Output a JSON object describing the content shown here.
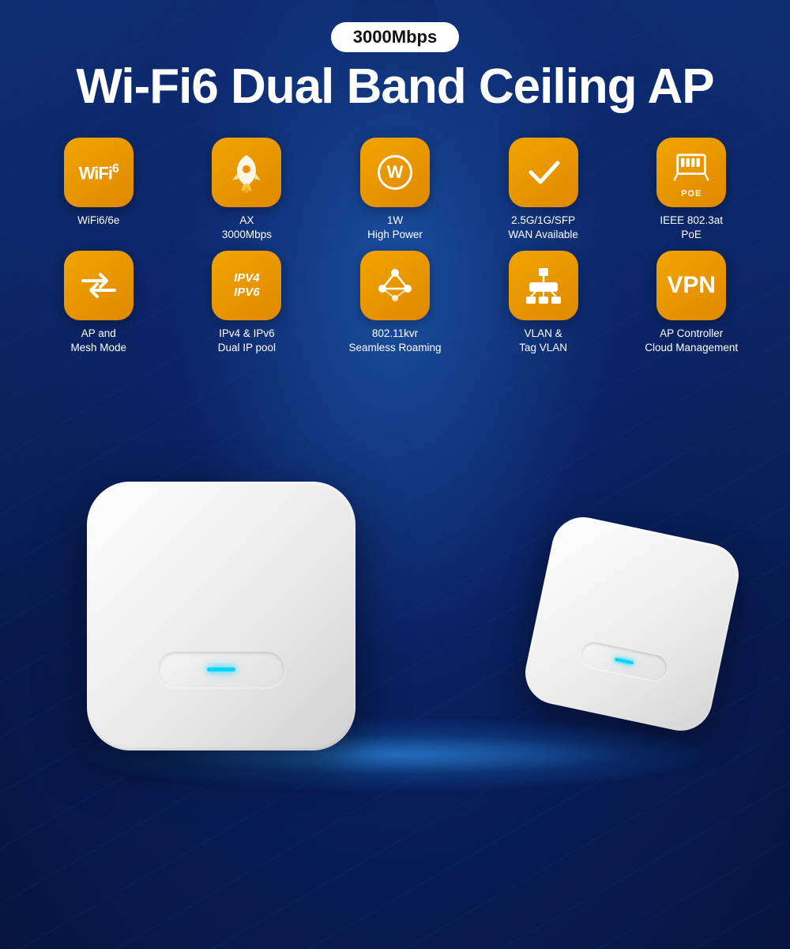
{
  "badge": {
    "text": "3000Mbps"
  },
  "title": {
    "line1": "Wi-Fi6  Dual Band Ceiling AP"
  },
  "features": {
    "row1": [
      {
        "id": "wifi6",
        "type": "wifi6-text",
        "label": "WiFi6/6e"
      },
      {
        "id": "ax",
        "type": "rocket",
        "label": "AX\n3000Mbps"
      },
      {
        "id": "power",
        "type": "w-circle",
        "label": "1W\nHigh Power"
      },
      {
        "id": "wan",
        "type": "check",
        "label": "2.5G/1G/SFP\nWAN Available"
      },
      {
        "id": "poe",
        "type": "poe",
        "label": "IEEE 802.3at\nPoE"
      }
    ],
    "row2": [
      {
        "id": "ap-mesh",
        "type": "arrows",
        "label": "AP and\nMesh Mode"
      },
      {
        "id": "ipv",
        "type": "ipv-text",
        "label": "IPv4 & IPv6\nDual IP pool"
      },
      {
        "id": "roaming",
        "type": "mesh-nodes",
        "label": "802.11kvr\nSeamless Roaming"
      },
      {
        "id": "vlan",
        "type": "network-switch",
        "label": "VLAN &\nTag VLAN"
      },
      {
        "id": "vpn",
        "type": "vpn-text",
        "label": "AP Controller\nCloud Management"
      }
    ]
  },
  "colors": {
    "icon_bg": "#e89400",
    "icon_bg_dark": "#c47800",
    "accent_blue": "#00d4ff",
    "background": "#0a2060"
  }
}
